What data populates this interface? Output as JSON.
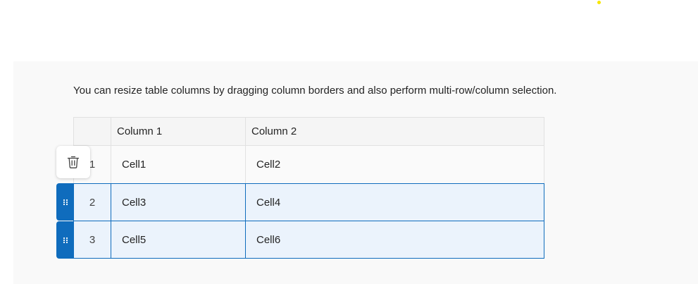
{
  "description": "You can resize table columns by dragging column borders and also perform multi-row/column selection.",
  "table": {
    "columns": [
      "Column 1",
      "Column 2"
    ],
    "rows": [
      {
        "index": "1",
        "cells": [
          "Cell1",
          "Cell2"
        ],
        "selected": false
      },
      {
        "index": "2",
        "cells": [
          "Cell3",
          "Cell4"
        ],
        "selected": true
      },
      {
        "index": "3",
        "cells": [
          "Cell5",
          "Cell6"
        ],
        "selected": true
      }
    ]
  },
  "icons": {
    "delete": "trash-icon",
    "drag": "drag-handle-icon"
  },
  "colors": {
    "accent": "#0f6cbd",
    "selected_bg": "#ebf3fc",
    "header_bg": "#f5f5f5",
    "panel_bg": "#f9f9f9"
  }
}
